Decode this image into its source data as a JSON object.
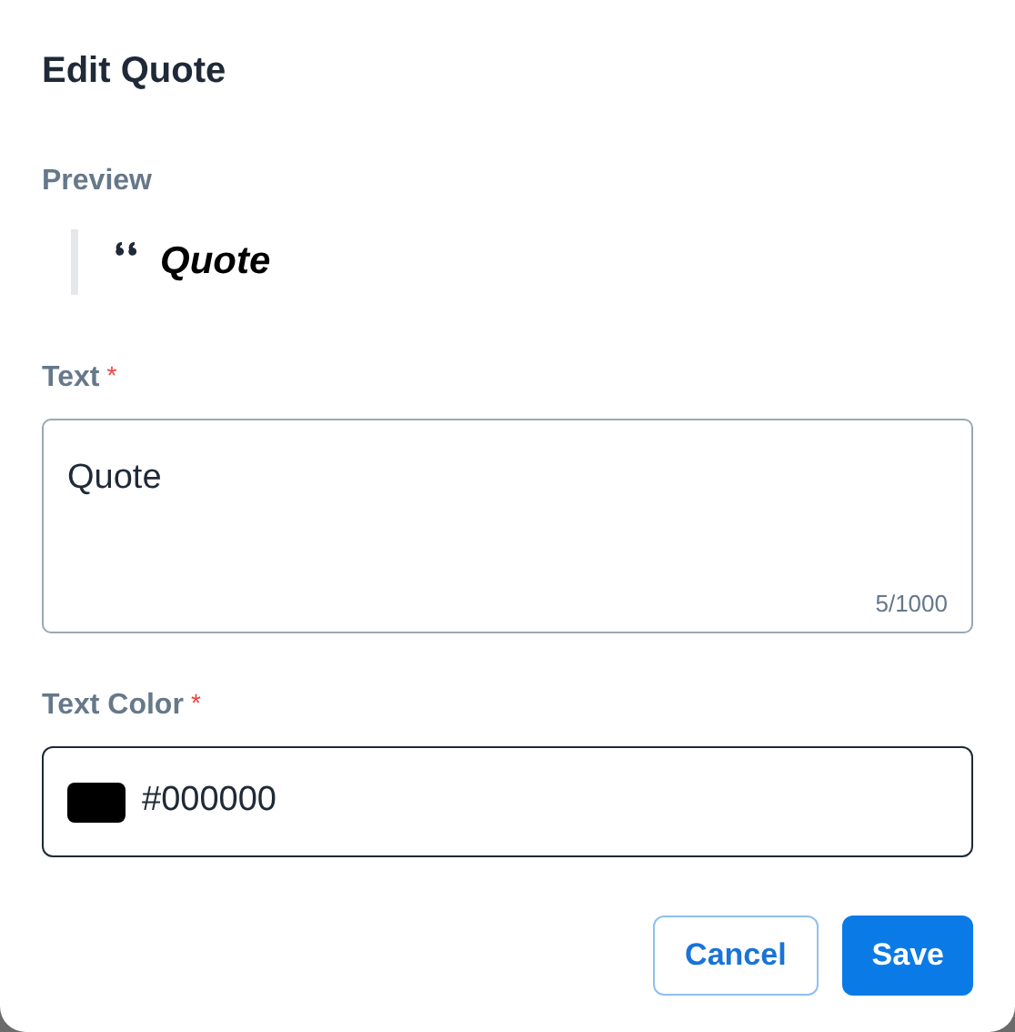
{
  "dialog": {
    "title": "Edit Quote"
  },
  "preview": {
    "label": "Preview",
    "quote": "Quote"
  },
  "text_field": {
    "label": "Text",
    "required_mark": "*",
    "value": "Quote",
    "counter": "5/1000"
  },
  "color_field": {
    "label": "Text Color",
    "required_mark": "*",
    "value": "#000000",
    "color": "#000000"
  },
  "buttons": [
    {
      "label": "Cancel",
      "kind": "secondary"
    },
    {
      "label": "Save",
      "kind": "primary"
    }
  ]
}
